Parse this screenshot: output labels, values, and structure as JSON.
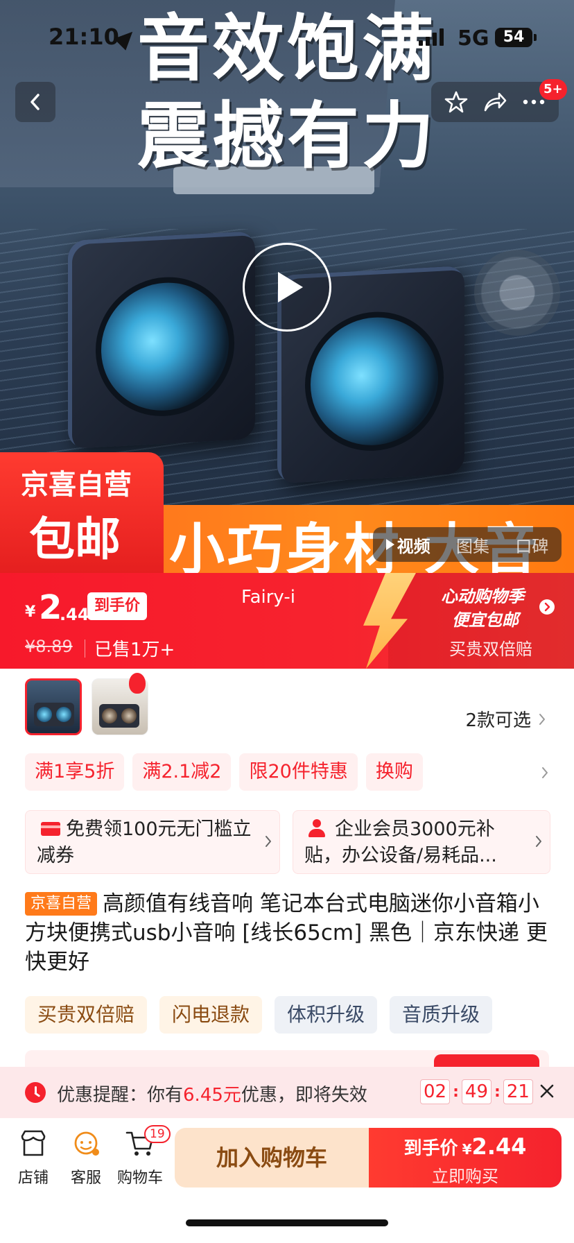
{
  "status_bar": {
    "time": "21:10",
    "network": "5G",
    "battery": "54"
  },
  "hero": {
    "title_line1": "音效饱满",
    "title_line2": "震撼有力",
    "banner_text": "小巧身材 大音量",
    "badge_line1": "京喜自营",
    "badge_line2": "包邮",
    "media_tabs": [
      "视频",
      "图集",
      "口碑"
    ],
    "more_badge": "5+"
  },
  "price_bar": {
    "currency": "¥",
    "price_int": "2",
    "price_dec": ".44",
    "price_tag": "到手价",
    "original_price": "¥8.89",
    "sold": "已售1万+",
    "live_user": "Fairy-i",
    "promo_line1": "心动购物季",
    "promo_line2": "便宜包邮",
    "promo_line3": "买贵双倍赔"
  },
  "variants": {
    "label": "2款可选"
  },
  "promo_chips": [
    "满1享5折",
    "满2.1减2",
    "限20件特惠",
    "换购"
  ],
  "benefits": [
    {
      "text": "免费领100元无门槛立减券"
    },
    {
      "text": "企业会员3000元补贴，办公设备/易耗品..."
    }
  ],
  "product": {
    "tag": "京喜自营",
    "title": "高颜值有线音响 笔记本台式电脑迷你小音箱小方块便携式usb小音响 [线长65cm] 黑色｜京东快递 更快更好"
  },
  "feature_chips": [
    "买贵双倍赔",
    "闪电退款",
    "体积升级",
    "音质升级"
  ],
  "reminder": {
    "prefix": "优惠提醒：你有",
    "amount": "6.45元",
    "suffix": "优惠，即将失效",
    "countdown": [
      "02",
      "49",
      "21"
    ]
  },
  "bottom_bar": {
    "store": "店铺",
    "service": "客服",
    "cart": "购物车",
    "cart_count": "19",
    "add_to_cart": "加入购物车",
    "buy_line1": "到手价",
    "buy_currency": "¥",
    "buy_price": "2.44",
    "buy_line2": "立即购买"
  },
  "colors": {
    "accent": "#f5222d",
    "orange": "#ff7a1a",
    "cart_button": "#fde3cb"
  }
}
